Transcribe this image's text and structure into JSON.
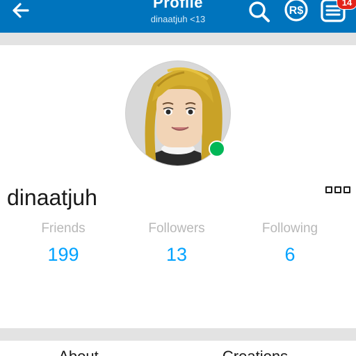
{
  "header": {
    "title": "Profile",
    "subtitle": "dinaatjuh <13",
    "notification_count": "14",
    "icons": [
      "back-arrow-icon",
      "search-icon",
      "robux-icon",
      "notifications-icon"
    ],
    "bar_color": "#0074bd",
    "badge_color": "#e2231a"
  },
  "profile": {
    "username": "dinaatjuh",
    "status": "online",
    "status_color": "#02b757"
  },
  "stats": [
    {
      "label": "Friends",
      "value": "199"
    },
    {
      "label": "Followers",
      "value": "13"
    },
    {
      "label": "Following",
      "value": "6"
    }
  ],
  "tabs": [
    "About",
    "Creations"
  ],
  "accent_color": "#00a2ff"
}
